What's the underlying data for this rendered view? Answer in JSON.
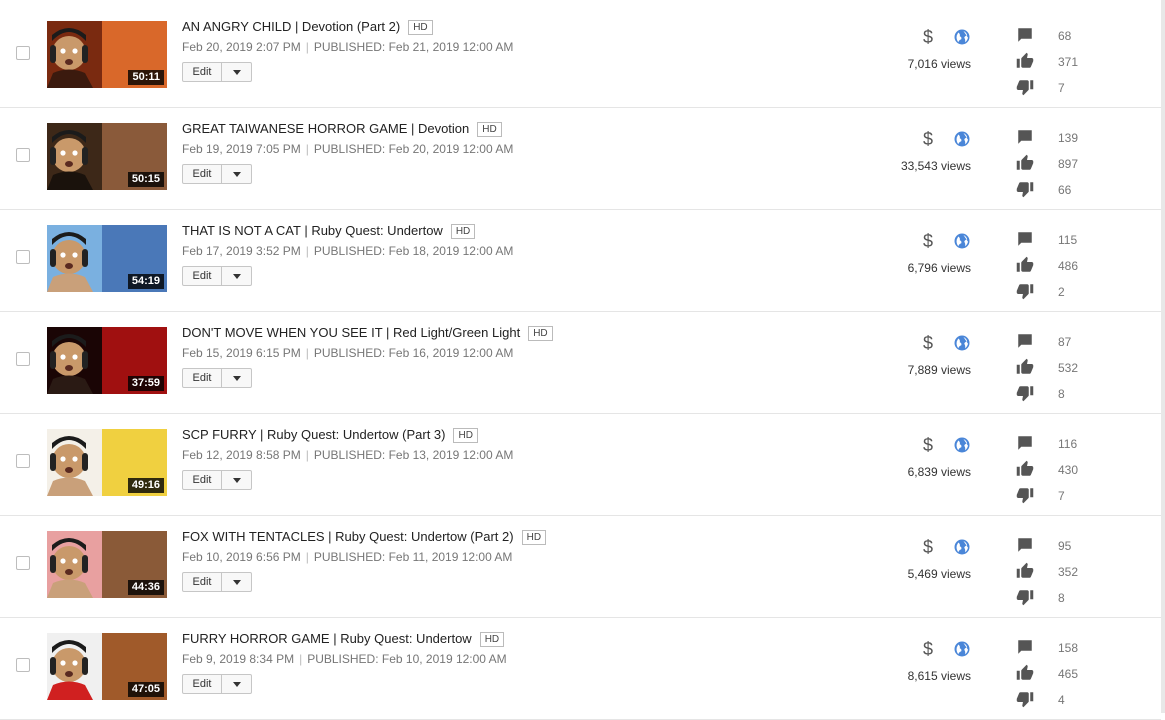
{
  "videos": [
    {
      "title": "AN ANGRY CHILD | Devotion (Part 2)",
      "hd": "HD",
      "uploaded": "Feb 20, 2019 2:07 PM",
      "published": "PUBLISHED: Feb 21, 2019 12:00 AM",
      "duration": "50:11",
      "edit": "Edit",
      "views": "7,016 views",
      "comments": "68",
      "likes": "371",
      "dislikes": "7",
      "thumb_colors": [
        "#7a2a10",
        "#d9682a",
        "#3b1a0e"
      ]
    },
    {
      "title": "GREAT TAIWANESE HORROR GAME | Devotion",
      "hd": "HD",
      "uploaded": "Feb 19, 2019 7:05 PM",
      "published": "PUBLISHED: Feb 20, 2019 12:00 AM",
      "duration": "50:15",
      "edit": "Edit",
      "views": "33,543 views",
      "comments": "139",
      "likes": "897",
      "dislikes": "66",
      "thumb_colors": [
        "#3d2818",
        "#8a5a3a",
        "#1a120c"
      ]
    },
    {
      "title": "THAT IS NOT A CAT | Ruby Quest: Undertow",
      "hd": "HD",
      "uploaded": "Feb 17, 2019 3:52 PM",
      "published": "PUBLISHED: Feb 18, 2019 12:00 AM",
      "duration": "54:19",
      "edit": "Edit",
      "views": "6,796 views",
      "comments": "115",
      "likes": "486",
      "dislikes": "2",
      "thumb_colors": [
        "#7ab0e0",
        "#4a78b8",
        "#c9a07a"
      ]
    },
    {
      "title": "DON'T MOVE WHEN YOU SEE IT | Red Light/Green Light",
      "hd": "HD",
      "uploaded": "Feb 15, 2019 6:15 PM",
      "published": "PUBLISHED: Feb 16, 2019 12:00 AM",
      "duration": "37:59",
      "edit": "Edit",
      "views": "7,889 views",
      "comments": "87",
      "likes": "532",
      "dislikes": "8",
      "thumb_colors": [
        "#1a0505",
        "#a01010",
        "#2a1a14"
      ]
    },
    {
      "title": "SCP FURRY | Ruby Quest: Undertow (Part 3)",
      "hd": "HD",
      "uploaded": "Feb 12, 2019 8:58 PM",
      "published": "PUBLISHED: Feb 13, 2019 12:00 AM",
      "duration": "49:16",
      "edit": "Edit",
      "views": "6,839 views",
      "comments": "116",
      "likes": "430",
      "dislikes": "7",
      "thumb_colors": [
        "#f4f0e8",
        "#f0d040",
        "#c9a07a"
      ]
    },
    {
      "title": "FOX WITH TENTACLES | Ruby Quest: Undertow (Part 2)",
      "hd": "HD",
      "uploaded": "Feb 10, 2019 6:56 PM",
      "published": "PUBLISHED: Feb 11, 2019 12:00 AM",
      "duration": "44:36",
      "edit": "Edit",
      "views": "5,469 views",
      "comments": "95",
      "likes": "352",
      "dislikes": "8",
      "thumb_colors": [
        "#e8a0a0",
        "#8a5a38",
        "#c9a07a"
      ]
    },
    {
      "title": "FURRY HORROR GAME | Ruby Quest: Undertow",
      "hd": "HD",
      "uploaded": "Feb 9, 2019 8:34 PM",
      "published": "PUBLISHED: Feb 10, 2019 12:00 AM",
      "duration": "47:05",
      "edit": "Edit",
      "views": "8,615 views",
      "comments": "158",
      "likes": "465",
      "dislikes": "4",
      "thumb_colors": [
        "#f0f0f0",
        "#a05a2a",
        "#d02020"
      ]
    }
  ],
  "icons": {
    "monetization": "dollar-icon",
    "visibility": "globe-icon",
    "comments": "comment-icon",
    "likes": "thumbs-up-icon",
    "dislikes": "thumbs-down-icon",
    "menu": "chevron-down-icon"
  },
  "colors": {
    "globe": "#4a86d8",
    "icon_gray": "#555555",
    "meta_gray": "#767676"
  }
}
